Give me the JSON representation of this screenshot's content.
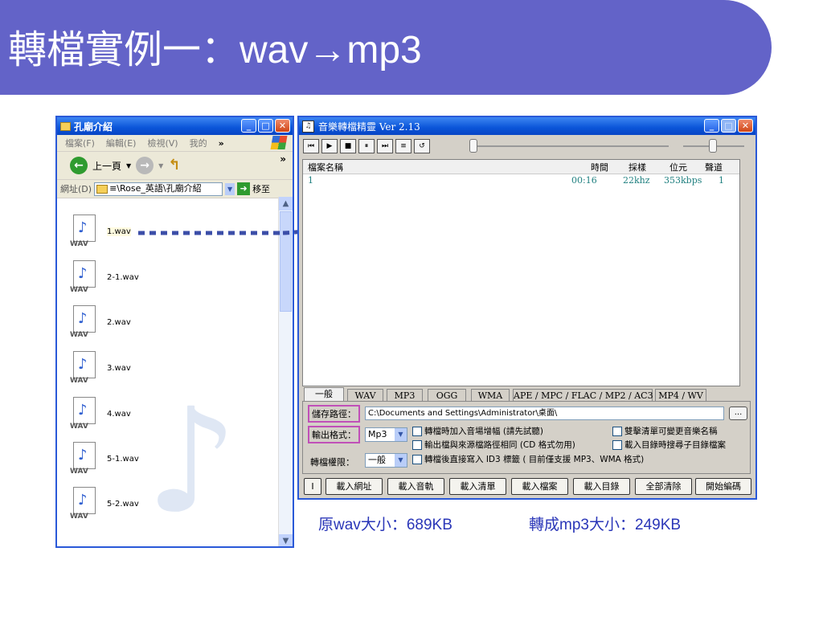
{
  "slide": {
    "title_cn": "轉檔實例一：",
    "title_en": "wav→mp3"
  },
  "explorer": {
    "title": "孔廟介紹",
    "menu": [
      "檔案(F)",
      "編輯(E)",
      "檢視(V)",
      "我的"
    ],
    "menu_more": "»",
    "back_label": "上一頁",
    "more": "»",
    "address_label": "網址(D)",
    "address_value": "≡\\Rose_英語\\孔廟介紹",
    "go_label": "移至",
    "files": [
      {
        "name": "1.wav",
        "icon_label": "WAV"
      },
      {
        "name": "2-1.wav",
        "icon_label": "WAV"
      },
      {
        "name": "2.wav",
        "icon_label": "WAV"
      },
      {
        "name": "3.wav",
        "icon_label": "WAV"
      },
      {
        "name": "4.wav",
        "icon_label": "WAV"
      },
      {
        "name": "5-1.wav",
        "icon_label": "WAV"
      },
      {
        "name": "5-2.wav",
        "icon_label": "WAV"
      }
    ]
  },
  "converter": {
    "title": "音樂轉檔精靈 Ver 2.13",
    "list": {
      "headers": [
        "檔案名稱",
        "時間",
        "採樣",
        "位元",
        "聲道"
      ],
      "rows": [
        [
          "1",
          "00:16",
          "22khz",
          "353kbps",
          "1"
        ]
      ]
    },
    "tabs": [
      "一般",
      "WAV",
      "MP3",
      "OGG",
      "WMA",
      "APE / MPC / FLAC / MP2 / AC3",
      "MP4 / WV"
    ],
    "save_path_label": "儲存路徑：",
    "save_path_value": "C:\\Documents and Settings\\Administrator\\桌面\\",
    "browse_label": "...",
    "format_label": "輸出格式：",
    "format_value": "Mp3",
    "priority_label": "轉檔權限：",
    "priority_value": "一般",
    "options": [
      "轉檔時加入音場增幅 (請先試聽)",
      "輸出檔與來源檔路徑相同 (CD 格式勿用)",
      "轉檔後直接寫入 ID3 標籤 ( 目前僅支援 MP3、WMA 格式)",
      "雙擊清單可變更音樂名稱",
      "載入目錄時搜尋子目錄檔案"
    ],
    "buttons": [
      "I",
      "載入網址",
      "載入音軌",
      "載入清單",
      "載入檔案",
      "載入目錄",
      "全部清除",
      "開始編碼"
    ]
  },
  "captions": {
    "orig_prefix": "原",
    "orig_en": "wav",
    "orig_suffix": "大小：",
    "orig_size": "689KB",
    "conv_prefix": "轉成",
    "conv_en": "mp3",
    "conv_suffix": "大小：",
    "conv_size": "249KB"
  },
  "colors": {
    "banner": "#6363c8",
    "xp_blue": "#0a54d8",
    "highlight": "#c050b8",
    "caption": "#2a36b8",
    "arrow": "#3b4ea8"
  }
}
